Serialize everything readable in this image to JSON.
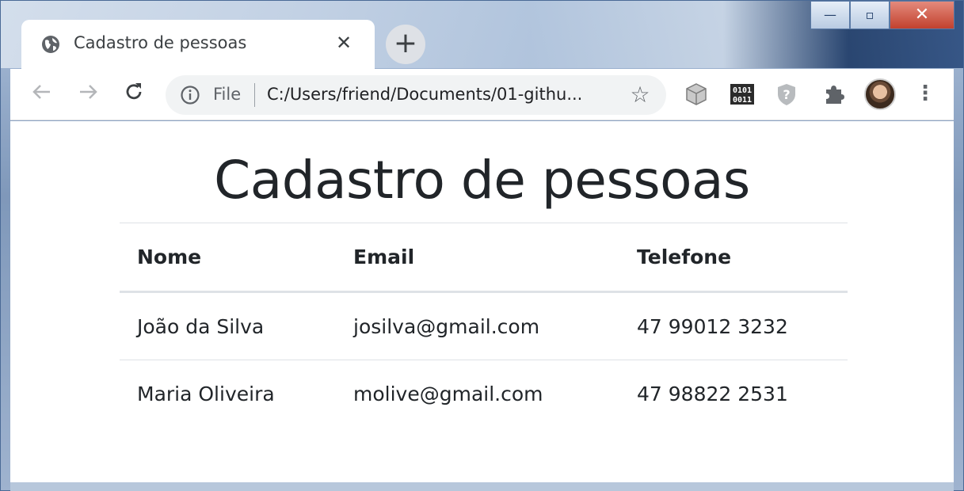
{
  "browser": {
    "tab_title": "Cadastro de pessoas",
    "tab_close_label": "✕",
    "new_tab_label": "+",
    "address_scheme_label": "File",
    "address_url": "C:/Users/friend/Documents/01-githu...",
    "window_controls": {
      "minimize": "—",
      "maximize": "▫",
      "close": "✕"
    },
    "extensions": [
      "cube-extension-icon",
      "binary-extension-icon",
      "shield-question-extension-icon",
      "puzzle-extensions-icon"
    ],
    "accent_color": "#dee1e6"
  },
  "page": {
    "title": "Cadastro de pessoas",
    "table": {
      "headers": [
        "Nome",
        "Email",
        "Telefone"
      ],
      "rows": [
        [
          "João da Silva",
          "josilva@gmail.com",
          "47 99012 3232"
        ],
        [
          "Maria Oliveira",
          "molive@gmail.com",
          "47 98822 2531"
        ]
      ]
    }
  }
}
